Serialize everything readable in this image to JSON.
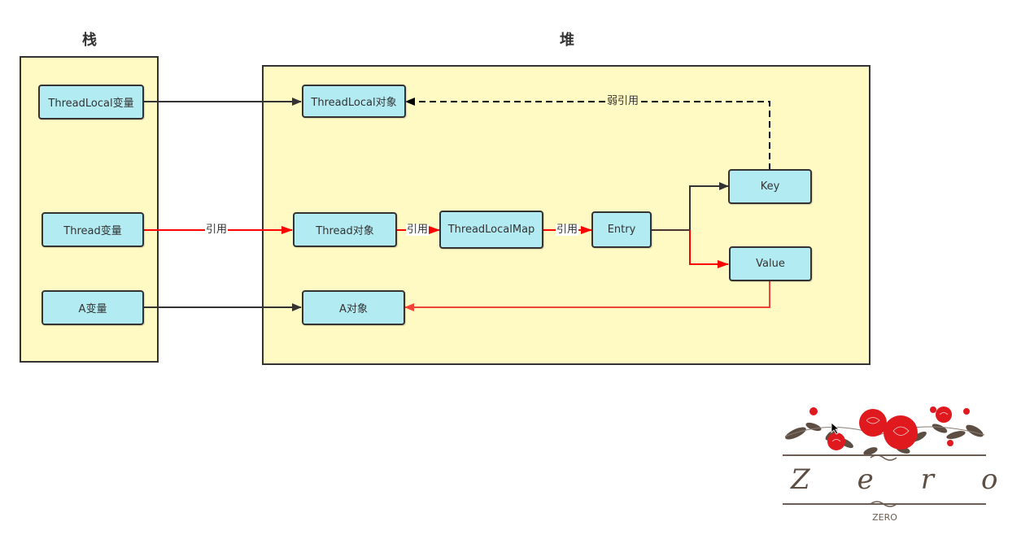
{
  "regions": {
    "stack": {
      "title": "栈"
    },
    "heap": {
      "title": "堆"
    }
  },
  "nodes": {
    "threadlocal_var": "ThreadLocal变量",
    "thread_var": "Thread变量",
    "a_var": "A变量",
    "threadlocal_obj": "ThreadLocal对象",
    "thread_obj": "Thread对象",
    "threadlocalmap": "ThreadLocalMap",
    "entry": "Entry",
    "key": "Key",
    "value": "Value",
    "a_obj": "A对象"
  },
  "edges": {
    "weak_ref_label": "弱引用",
    "ref_label_1": "引用",
    "ref_label_2": "引用",
    "ref_label_3": "引用"
  },
  "colors": {
    "strong_ref": "#333333",
    "thread_chain_ref": "#ff0000",
    "value_to_a_ref": "#f44336",
    "region_fill": "#fff9c4",
    "node_fill": "#b2ebf2"
  },
  "logo": {
    "script_text": "Zero",
    "caption": "ZERO"
  }
}
